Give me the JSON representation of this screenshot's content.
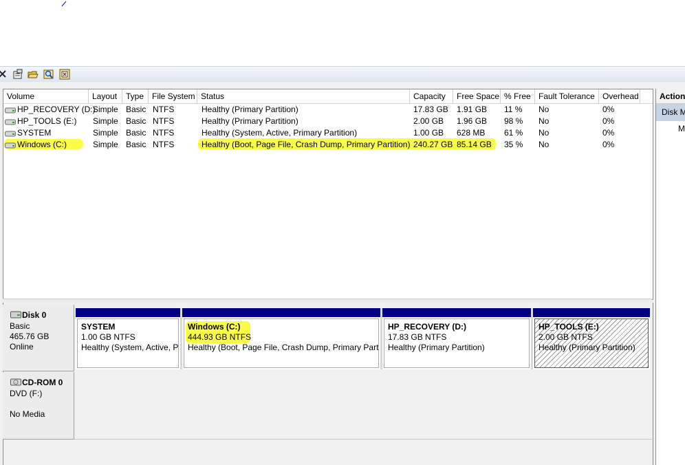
{
  "icons": {
    "close": "close-icon",
    "properties": "properties-icon",
    "open": "open-folder-icon",
    "search": "search-icon",
    "help": "help-icon",
    "drive": "drive-icon",
    "disk": "disk-icon",
    "cdrom": "cdrom-icon"
  },
  "colors": {
    "highlight": "#fbfb4a",
    "partition_bar": "#000080",
    "actions_selected": "#c6d4e8"
  },
  "volume_list": {
    "columns": [
      "Volume",
      "Layout",
      "Type",
      "File System",
      "Status",
      "Capacity",
      "Free Space",
      "% Free",
      "Fault Tolerance",
      "Overhead"
    ],
    "rows": [
      {
        "volume": "HP_RECOVERY (D:)",
        "layout": "Simple",
        "type": "Basic",
        "fs": "NTFS",
        "status": "Healthy (Primary Partition)",
        "capacity": "17.83 GB",
        "free": "1.91 GB",
        "pct": "11 %",
        "fault": "No",
        "overhead": "0%"
      },
      {
        "volume": "HP_TOOLS (E:)",
        "layout": "Simple",
        "type": "Basic",
        "fs": "NTFS",
        "status": "Healthy (Primary Partition)",
        "capacity": "2.00 GB",
        "free": "1.96 GB",
        "pct": "98 %",
        "fault": "No",
        "overhead": "0%"
      },
      {
        "volume": "SYSTEM",
        "layout": "Simple",
        "type": "Basic",
        "fs": "NTFS",
        "status": "Healthy (System, Active, Primary Partition)",
        "capacity": "1.00 GB",
        "free": "628 MB",
        "pct": "61 %",
        "fault": "No",
        "overhead": "0%"
      },
      {
        "volume": "Windows (C:)",
        "layout": "Simple",
        "type": "Basic",
        "fs": "NTFS",
        "status": "Healthy (Boot, Page File, Crash Dump, Primary Partition)",
        "capacity": "240.27 GB",
        "free": "85.14 GB",
        "pct": "35 %",
        "fault": "No",
        "overhead": "0%"
      }
    ]
  },
  "disks": [
    {
      "name": "Disk 0",
      "type": "Basic",
      "size": "465.76 GB",
      "state": "Online",
      "partitions": [
        {
          "name": "SYSTEM",
          "size": "1.00 GB NTFS",
          "status": "Healthy (System, Active, P"
        },
        {
          "name": "Windows  (C:)",
          "size": "444.93 GB NTFS",
          "status": "Healthy (Boot, Page File, Crash Dump, Primary Partit"
        },
        {
          "name": "HP_RECOVERY  (D:)",
          "size": "17.83 GB NTFS",
          "status": "Healthy (Primary Partition)"
        },
        {
          "name": "HP_TOOLS  (E:)",
          "size": "2.00 GB NTFS",
          "status": "Healthy (Primary Partition)"
        }
      ]
    },
    {
      "name": "CD-ROM 0",
      "type": "DVD (F:)",
      "state": "No Media"
    }
  ],
  "actions": {
    "title": "Actions",
    "item": "Disk Management",
    "sub": "More Actions"
  }
}
